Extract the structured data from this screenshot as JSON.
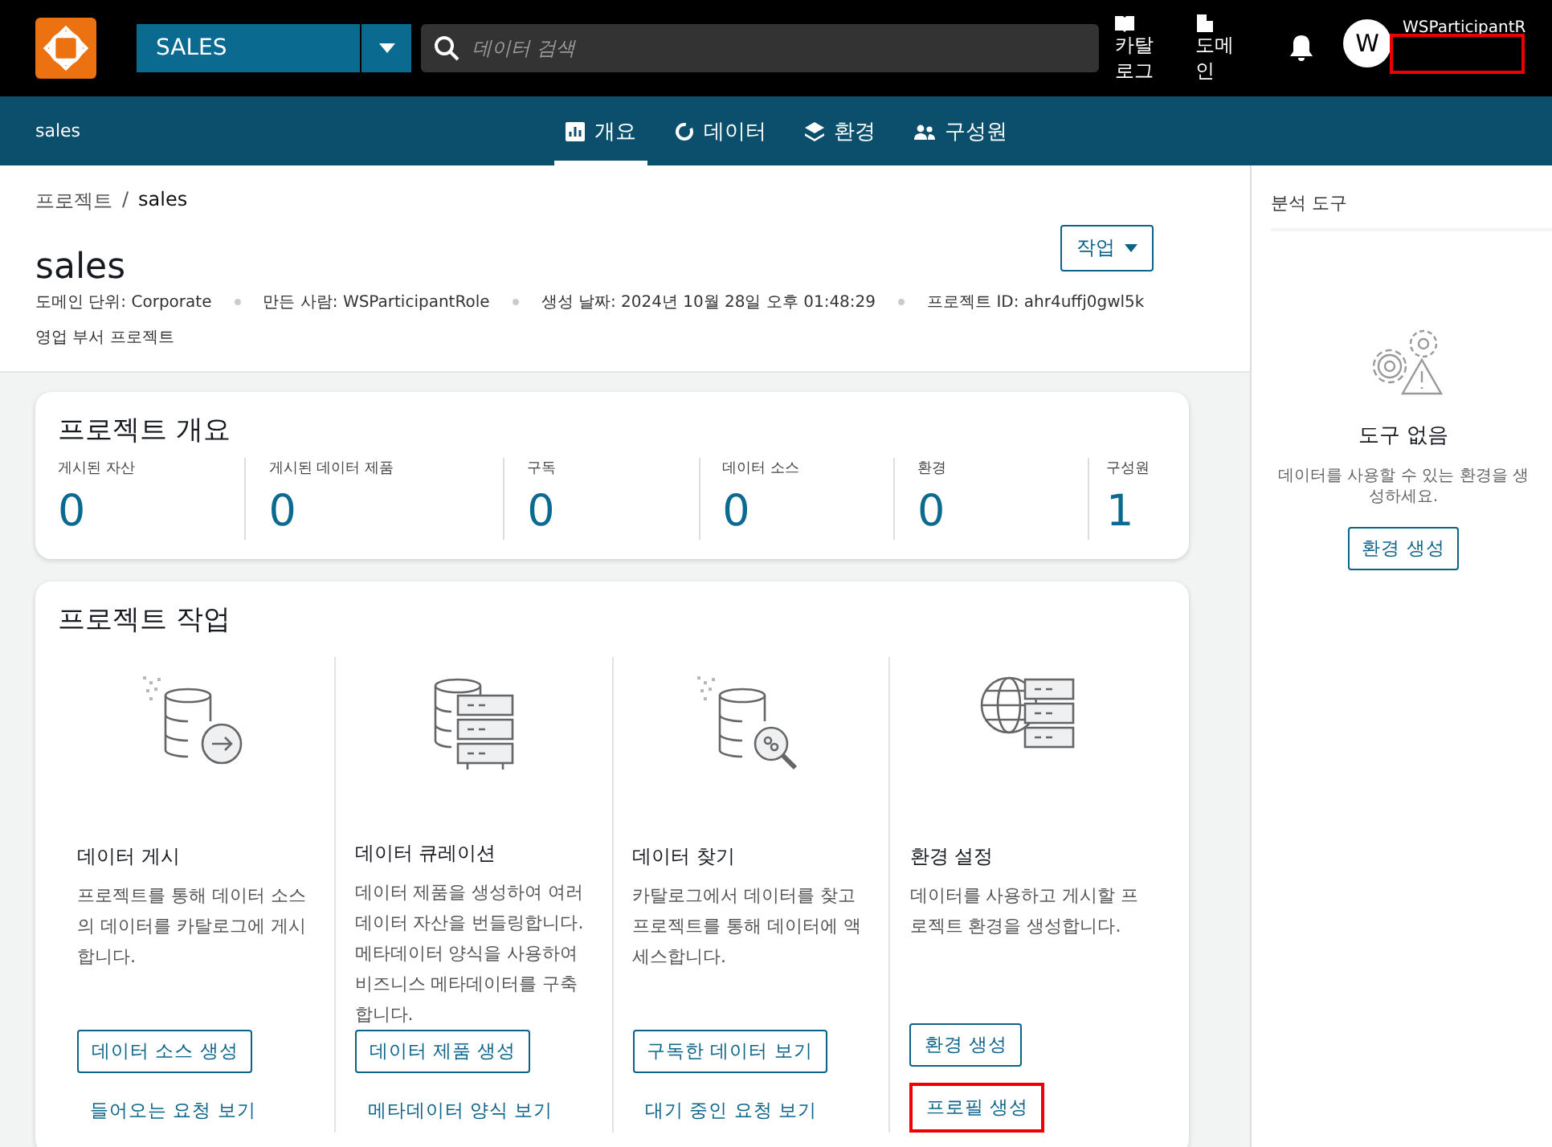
{
  "header": {
    "project_selector": {
      "value": "SALES"
    },
    "search": {
      "placeholder": "데이터 검색"
    },
    "nav_links": [
      {
        "label": "카탈로그",
        "kind": "book"
      },
      {
        "label": "도메인",
        "kind": "building"
      }
    ],
    "user": {
      "avatar": "W",
      "name": "WSParticipantR",
      "highlighted": true
    }
  },
  "subnav": {
    "project_name": "sales",
    "tabs": [
      {
        "label": "개요",
        "kind": "chart",
        "selected": true
      },
      {
        "label": "데이터",
        "kind": "circle",
        "selected": false
      },
      {
        "label": "환경",
        "kind": "layers",
        "selected": false
      },
      {
        "label": "구성원",
        "kind": "people",
        "selected": false
      }
    ]
  },
  "breadcrumb": {
    "separator": "/",
    "items": [
      {
        "label": "프로젝트",
        "link": true
      },
      {
        "label": "sales",
        "link": false
      }
    ]
  },
  "project": {
    "title": "sales",
    "meta": [
      "도메인 단위: Corporate",
      "만든 사람: WSParticipantRole",
      "생성 날짜: 2024년 10월 28일 오후 01:48:29",
      "프로젝트 ID: ahr4uffj0gwl5k"
    ],
    "description": "영업 부서 프로젝트",
    "actions_button": "작업"
  },
  "overview": {
    "title": "프로젝트 개요",
    "stats": [
      {
        "label": "게시된 자산",
        "value": "0"
      },
      {
        "label": "게시된 데이터 제품",
        "value": "0"
      },
      {
        "label": "구독",
        "value": "0"
      },
      {
        "label": "데이터 소스",
        "value": "0"
      },
      {
        "label": "환경",
        "value": "0"
      },
      {
        "label": "구성원",
        "value": "1"
      }
    ]
  },
  "tasks": {
    "title": "프로젝트 작업",
    "items": [
      {
        "kind": "db-arrow",
        "title": "데이터 게시",
        "description": "프로젝트를 통해 데이터 소스의 데이터를 카탈로그에 게시합니다.",
        "button": "데이터 소스 생성",
        "link": "들어오는 요청 보기",
        "highlighted": false
      },
      {
        "kind": "db-servers",
        "title": "데이터 큐레이션",
        "description": "데이터 제품을 생성하여 여러 데이터 자산을 번들링합니다. 메타데이터 양식을 사용하여 비즈니스 메타데이터를 구축합니다.",
        "button": "데이터 제품 생성",
        "link": "메타데이터 양식 보기",
        "highlighted": false
      },
      {
        "kind": "db-search",
        "title": "데이터 찾기",
        "description": "카탈로그에서 데이터를 찾고 프로젝트를 통해 데이터에 액세스합니다.",
        "button": "구독한 데이터 보기",
        "link": "대기 중인 요청 보기",
        "highlighted": false
      },
      {
        "kind": "globe-servers",
        "title": "환경 설정",
        "description": "데이터를 사용하고 게시할 프로젝트 환경을 생성합니다.",
        "button": "환경 생성",
        "link": "프로필 생성",
        "highlighted": true
      }
    ]
  },
  "side_panel": {
    "title": "분석 도구",
    "empty_title": "도구 없음",
    "empty_message": "데이터를 사용할 수 있는 환경을 생성하세요.",
    "button": "환경 생성"
  }
}
